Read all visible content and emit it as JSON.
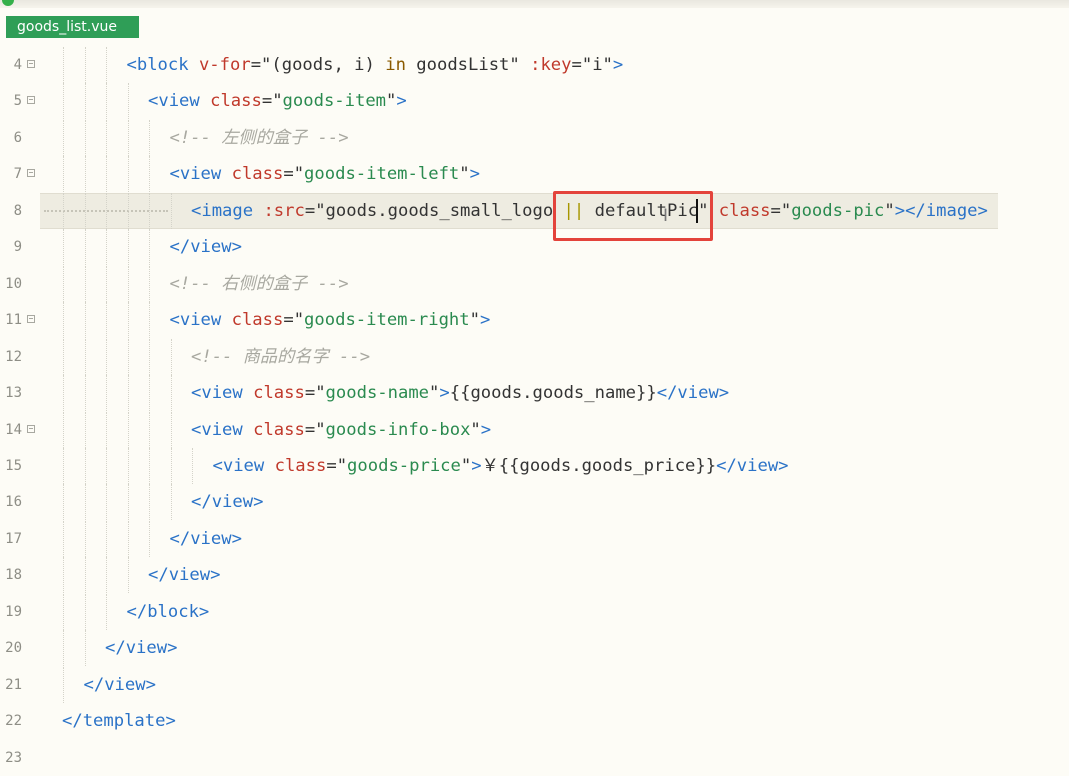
{
  "tab": {
    "label": "goods_list.vue"
  },
  "lines": [
    {
      "n": "4",
      "fold": true,
      "indent": 3,
      "segs": [
        [
          "t",
          "<block "
        ],
        [
          "a",
          "v-for"
        ],
        [
          "p",
          "=\"(goods, i) "
        ],
        [
          "k",
          "in"
        ],
        [
          "p",
          " goodsList\" "
        ],
        [
          "a",
          ":key"
        ],
        [
          "p",
          "=\"i\""
        ],
        [
          "t",
          ">"
        ]
      ]
    },
    {
      "n": "5",
      "fold": true,
      "indent": 4,
      "segs": [
        [
          "t",
          "<view "
        ],
        [
          "a",
          "class"
        ],
        [
          "p",
          "=\""
        ],
        [
          "s",
          "goods-item"
        ],
        [
          "p",
          "\""
        ],
        [
          "t",
          ">"
        ]
      ]
    },
    {
      "n": "6",
      "fold": false,
      "indent": 5,
      "segs": [
        [
          "c",
          "<!-- 左侧的盒子 -->"
        ]
      ]
    },
    {
      "n": "7",
      "fold": true,
      "indent": 5,
      "segs": [
        [
          "t",
          "<view "
        ],
        [
          "a",
          "class"
        ],
        [
          "p",
          "=\""
        ],
        [
          "s",
          "goods-item-left"
        ],
        [
          "p",
          "\""
        ],
        [
          "t",
          ">"
        ]
      ]
    },
    {
      "n": "8",
      "fold": false,
      "indent": 6,
      "segs": [
        [
          "t",
          "<image "
        ],
        [
          "a",
          ":src"
        ],
        [
          "p",
          "=\"goods.goods_small_logo "
        ],
        [
          "o",
          "||"
        ],
        [
          "p",
          " defaultPic\" "
        ],
        [
          "a",
          "class"
        ],
        [
          "p",
          "=\""
        ],
        [
          "s",
          "goods-pic"
        ],
        [
          "p",
          "\""
        ],
        [
          "t",
          "></image>"
        ]
      ]
    },
    {
      "n": "9",
      "fold": false,
      "indent": 5,
      "segs": [
        [
          "t",
          "</view>"
        ]
      ]
    },
    {
      "n": "10",
      "fold": false,
      "indent": 5,
      "segs": [
        [
          "c",
          "<!-- 右侧的盒子 -->"
        ]
      ]
    },
    {
      "n": "11",
      "fold": true,
      "indent": 5,
      "segs": [
        [
          "t",
          "<view "
        ],
        [
          "a",
          "class"
        ],
        [
          "p",
          "=\""
        ],
        [
          "s",
          "goods-item-right"
        ],
        [
          "p",
          "\""
        ],
        [
          "t",
          ">"
        ]
      ]
    },
    {
      "n": "12",
      "fold": false,
      "indent": 6,
      "segs": [
        [
          "c",
          "<!-- 商品的名字 -->"
        ]
      ]
    },
    {
      "n": "13",
      "fold": false,
      "indent": 6,
      "segs": [
        [
          "t",
          "<view "
        ],
        [
          "a",
          "class"
        ],
        [
          "p",
          "=\""
        ],
        [
          "s",
          "goods-name"
        ],
        [
          "p",
          "\""
        ],
        [
          "t",
          ">"
        ],
        [
          "p",
          "{{goods.goods_name}}"
        ],
        [
          "t",
          "</view>"
        ]
      ]
    },
    {
      "n": "14",
      "fold": true,
      "indent": 6,
      "segs": [
        [
          "t",
          "<view "
        ],
        [
          "a",
          "class"
        ],
        [
          "p",
          "=\""
        ],
        [
          "s",
          "goods-info-box"
        ],
        [
          "p",
          "\""
        ],
        [
          "t",
          ">"
        ]
      ]
    },
    {
      "n": "15",
      "fold": false,
      "indent": 7,
      "segs": [
        [
          "t",
          "<view "
        ],
        [
          "a",
          "class"
        ],
        [
          "p",
          "=\""
        ],
        [
          "s",
          "goods-price"
        ],
        [
          "p",
          "\""
        ],
        [
          "t",
          ">"
        ],
        [
          "p",
          "￥{{goods.goods_price}}"
        ],
        [
          "t",
          "</view>"
        ]
      ]
    },
    {
      "n": "16",
      "fold": false,
      "indent": 6,
      "segs": [
        [
          "t",
          "</view>"
        ]
      ]
    },
    {
      "n": "17",
      "fold": false,
      "indent": 5,
      "segs": [
        [
          "t",
          "</view>"
        ]
      ]
    },
    {
      "n": "18",
      "fold": false,
      "indent": 4,
      "segs": [
        [
          "t",
          "</view>"
        ]
      ]
    },
    {
      "n": "19",
      "fold": false,
      "indent": 3,
      "segs": [
        [
          "t",
          "</block>"
        ]
      ]
    },
    {
      "n": "20",
      "fold": false,
      "indent": 2,
      "segs": [
        [
          "t",
          "</view>"
        ]
      ]
    },
    {
      "n": "21",
      "fold": false,
      "indent": 1,
      "segs": [
        [
          "t",
          "</view>"
        ]
      ]
    },
    {
      "n": "22",
      "fold": false,
      "indent": 0,
      "segs": [
        [
          "t",
          "</template>"
        ]
      ]
    },
    {
      "n": "23",
      "fold": false,
      "indent": 0,
      "segs": []
    }
  ],
  "colors": {
    "tag": "#2a72c7",
    "attribute": "#c0392b",
    "string": "#2a8a4f",
    "keyword": "#8a5a00",
    "comment": "#a8a8a0",
    "highlight_box": "#e3433b",
    "tab_bg": "#2f9e57"
  },
  "icons": {
    "cursor": "i-beam-cursor",
    "fold": "fold-toggle-icon"
  }
}
